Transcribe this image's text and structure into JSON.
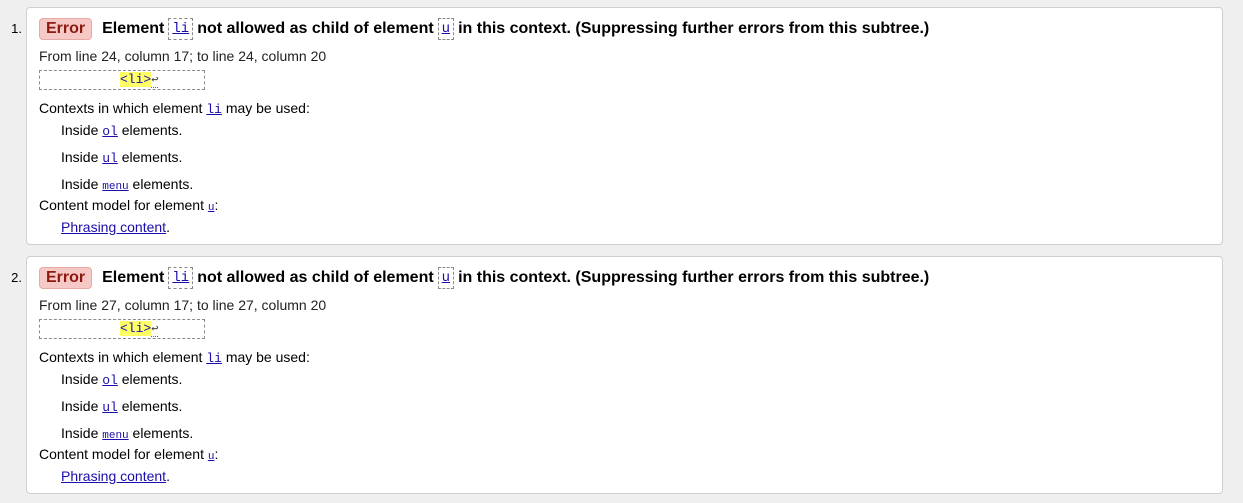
{
  "errors": [
    {
      "number": "1.",
      "badge": "Error",
      "message": {
        "prefix": "Element",
        "child": "li",
        "middle": "not allowed as child of element",
        "parent": "u",
        "suffix": "in this context. (Suppressing further errors from this subtree.)"
      },
      "location": "From line 24, column 17; to line 24, column 20",
      "extract": {
        "code": "<li>",
        "newline": "↩"
      },
      "contexts": {
        "label_prefix": "Contexts in which element",
        "element": "li",
        "label_suffix": "may be used:",
        "items": [
          {
            "prefix": "Inside",
            "element": "ol",
            "suffix": "elements."
          },
          {
            "prefix": "Inside",
            "element": "ul",
            "suffix": "elements."
          },
          {
            "prefix": "Inside",
            "element": "menu",
            "suffix": "elements."
          }
        ]
      },
      "content_model": {
        "label_prefix": "Content model for element",
        "element": "u",
        "label_suffix": ":",
        "link": "Phrasing content",
        "link_suffix": "."
      }
    },
    {
      "number": "2.",
      "badge": "Error",
      "message": {
        "prefix": "Element",
        "child": "li",
        "middle": "not allowed as child of element",
        "parent": "u",
        "suffix": "in this context. (Suppressing further errors from this subtree.)"
      },
      "location": "From line 27, column 17; to line 27, column 20",
      "extract": {
        "code": "<li>",
        "newline": "↩"
      },
      "contexts": {
        "label_prefix": "Contexts in which element",
        "element": "li",
        "label_suffix": "may be used:",
        "items": [
          {
            "prefix": "Inside",
            "element": "ol",
            "suffix": "elements."
          },
          {
            "prefix": "Inside",
            "element": "ul",
            "suffix": "elements."
          },
          {
            "prefix": "Inside",
            "element": "menu",
            "suffix": "elements."
          }
        ]
      },
      "content_model": {
        "label_prefix": "Content model for element",
        "element": "u",
        "label_suffix": ":",
        "link": "Phrasing content",
        "link_suffix": "."
      }
    }
  ],
  "colors": {
    "background": "#efefef",
    "card": "#ffffff",
    "error_badge_bg": "#f7c9c6",
    "link": "#1a0dab",
    "highlight": "#ffff66"
  }
}
